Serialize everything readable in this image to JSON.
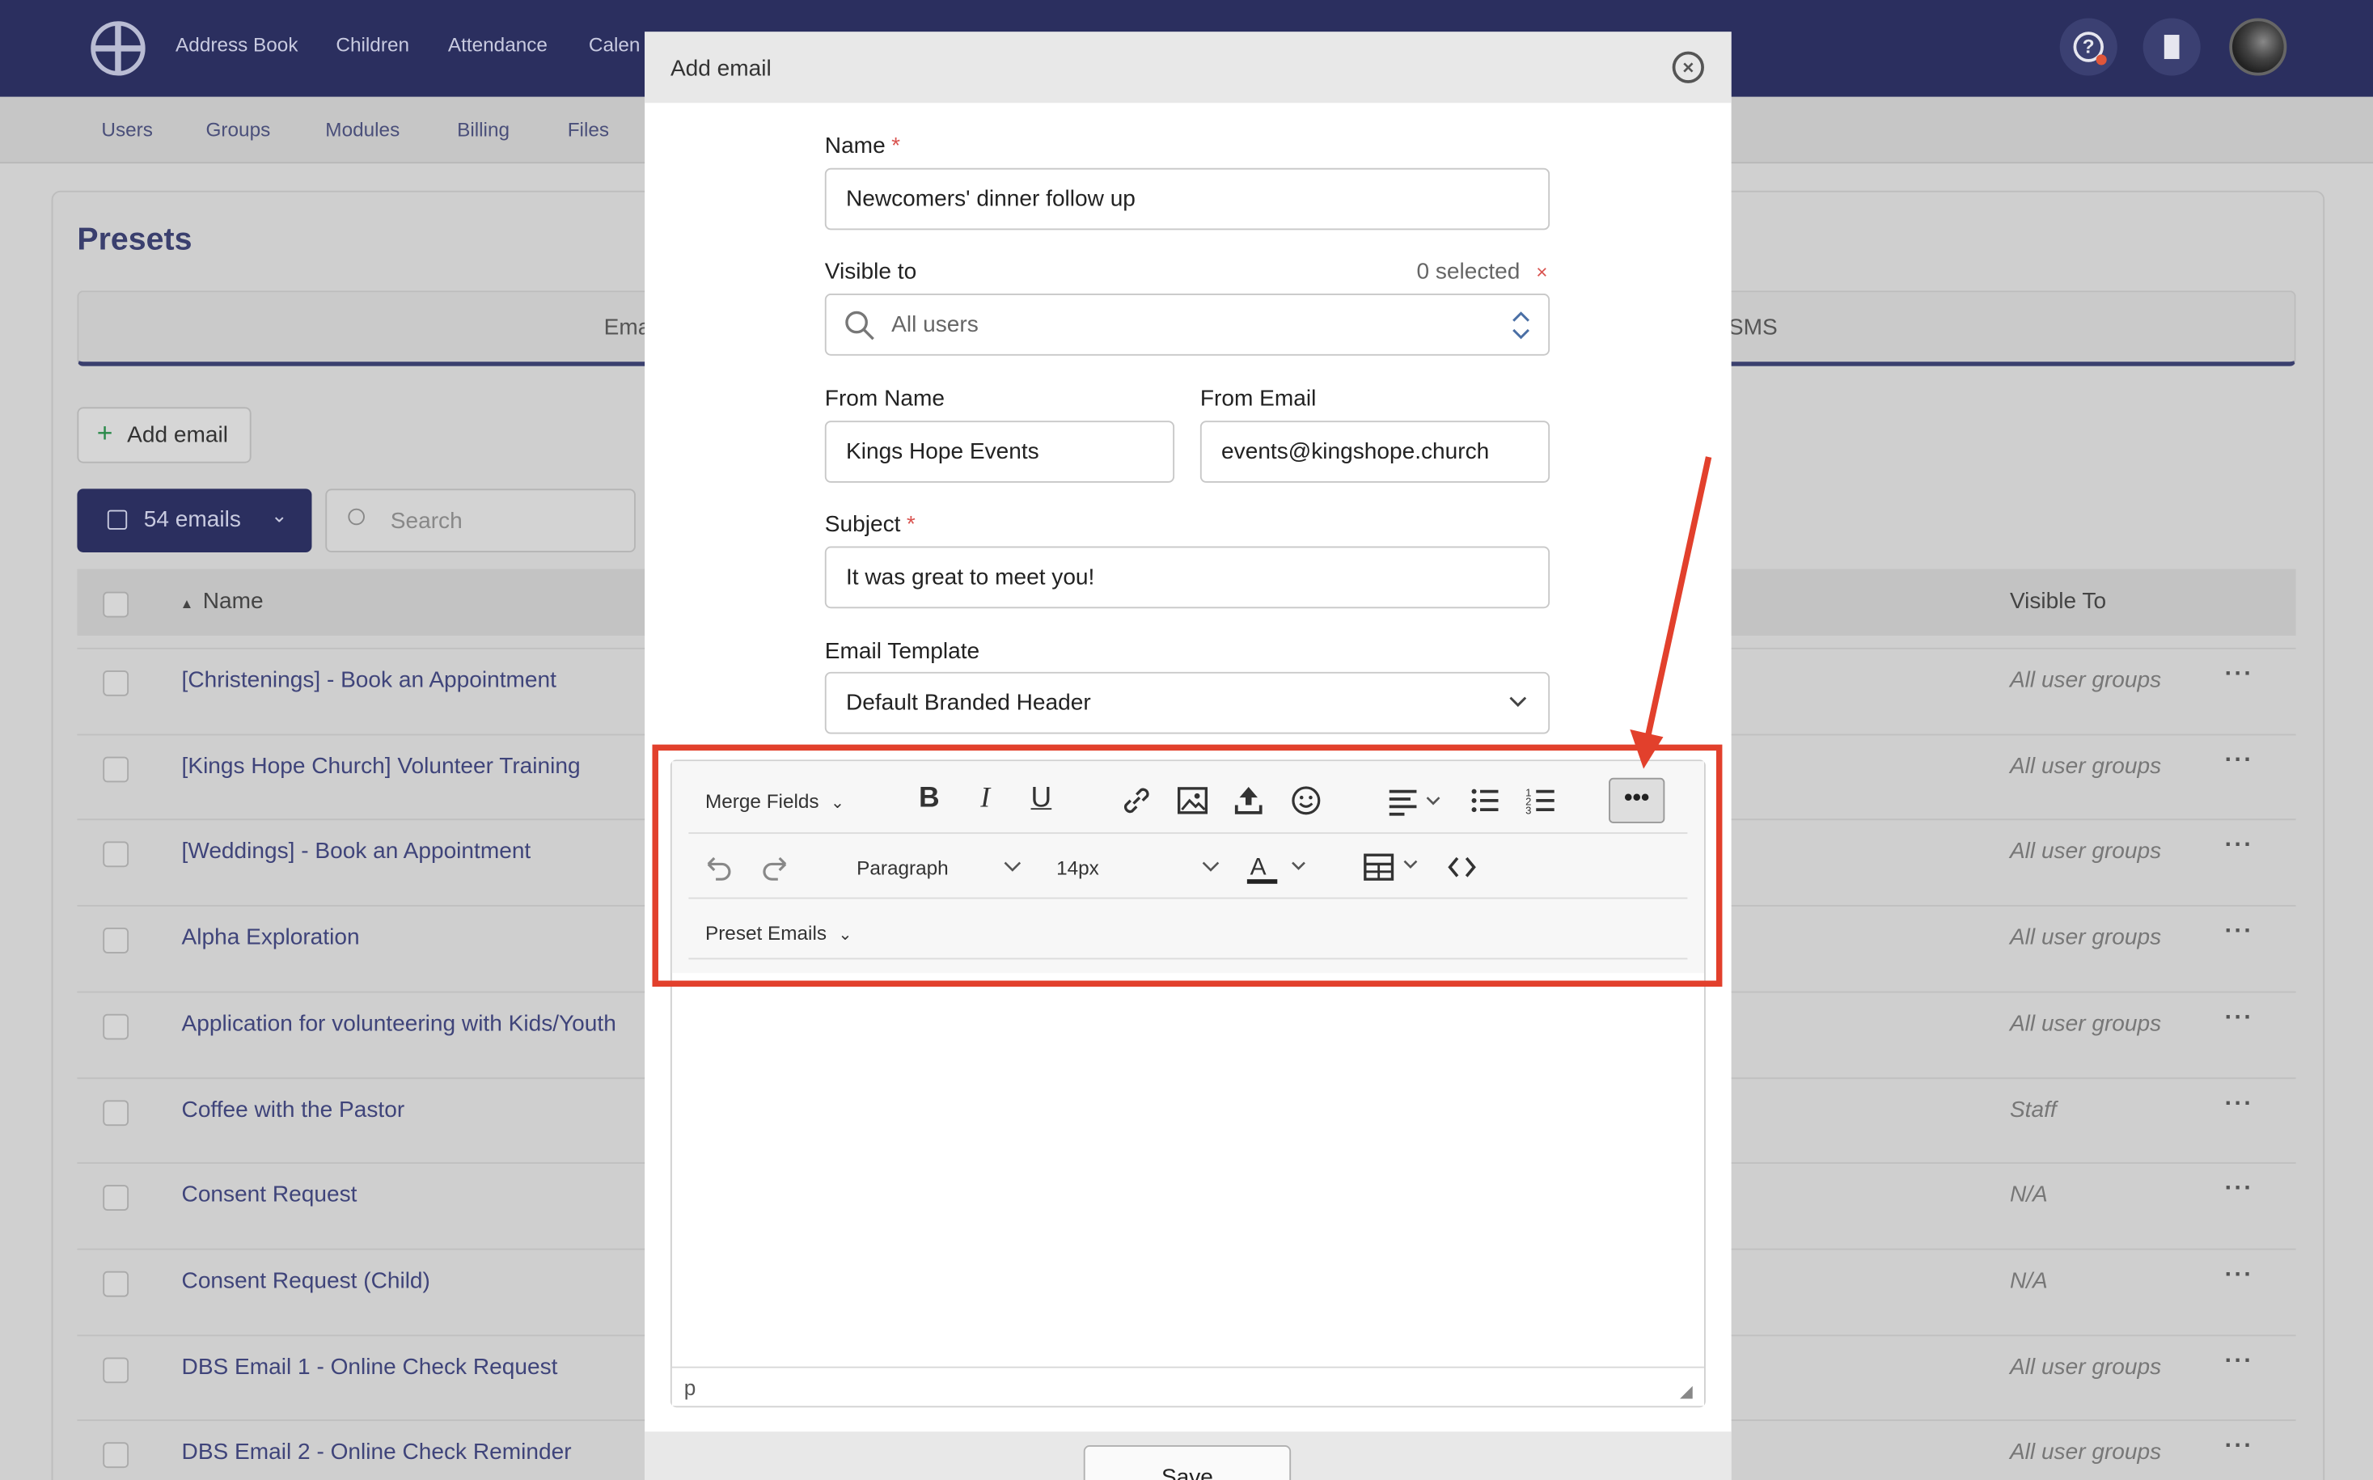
{
  "topnav": {
    "items": [
      "Address Book",
      "Children",
      "Attendance",
      "Calen"
    ]
  },
  "subnav": {
    "items": [
      "Users",
      "Groups",
      "Modules",
      "Billing",
      "Files"
    ]
  },
  "page": {
    "title": "Presets",
    "tabs": [
      "Ema",
      "SMS"
    ],
    "add_email_label": "Add email",
    "count_label": "54 emails",
    "search_placeholder": "Search",
    "columns": {
      "name": "Name",
      "visible_to": "Visible To"
    },
    "rows": [
      {
        "name": "[Christenings] - Book an Appointment",
        "visible": "All user groups"
      },
      {
        "name": "[Kings Hope Church] Volunteer Training",
        "visible": "All user groups"
      },
      {
        "name": "[Weddings] - Book an Appointment",
        "visible": "All user groups"
      },
      {
        "name": "Alpha Exploration",
        "visible": "All user groups"
      },
      {
        "name": "Application for volunteering with Kids/Youth",
        "visible": "All user groups"
      },
      {
        "name": "Coffee with the Pastor",
        "visible": "Staff"
      },
      {
        "name": "Consent Request",
        "visible": "N/A"
      },
      {
        "name": "Consent Request (Child)",
        "visible": "N/A"
      },
      {
        "name": "DBS Email 1 - Online Check Request",
        "visible": "All user groups"
      },
      {
        "name": "DBS Email 2 - Online Check Reminder",
        "visible": "All user groups"
      }
    ]
  },
  "modal": {
    "title": "Add email",
    "name_label": "Name",
    "name_value": "Newcomers' dinner follow up",
    "visible_label": "Visible to",
    "visible_count": "0 selected",
    "visible_clear": "×",
    "visible_value": "All users",
    "from_name_label": "From Name",
    "from_name_value": "Kings Hope Events",
    "from_email_label": "From Email",
    "from_email_value": "events@kingshope.church",
    "subject_label": "Subject",
    "subject_value": "It was great to meet you!",
    "template_label": "Email Template",
    "template_value": "Default Branded Header",
    "required_mark": "*",
    "save_label": "Save"
  },
  "editor": {
    "merge_fields": "Merge Fields",
    "block_format": "Paragraph",
    "font_size": "14px",
    "preset_emails": "Preset Emails",
    "status_path": "p",
    "more_label": "•••"
  },
  "colors": {
    "nav_bg": "#2b2f5f",
    "annotation": "#e2402c",
    "required": "#d9534f"
  }
}
